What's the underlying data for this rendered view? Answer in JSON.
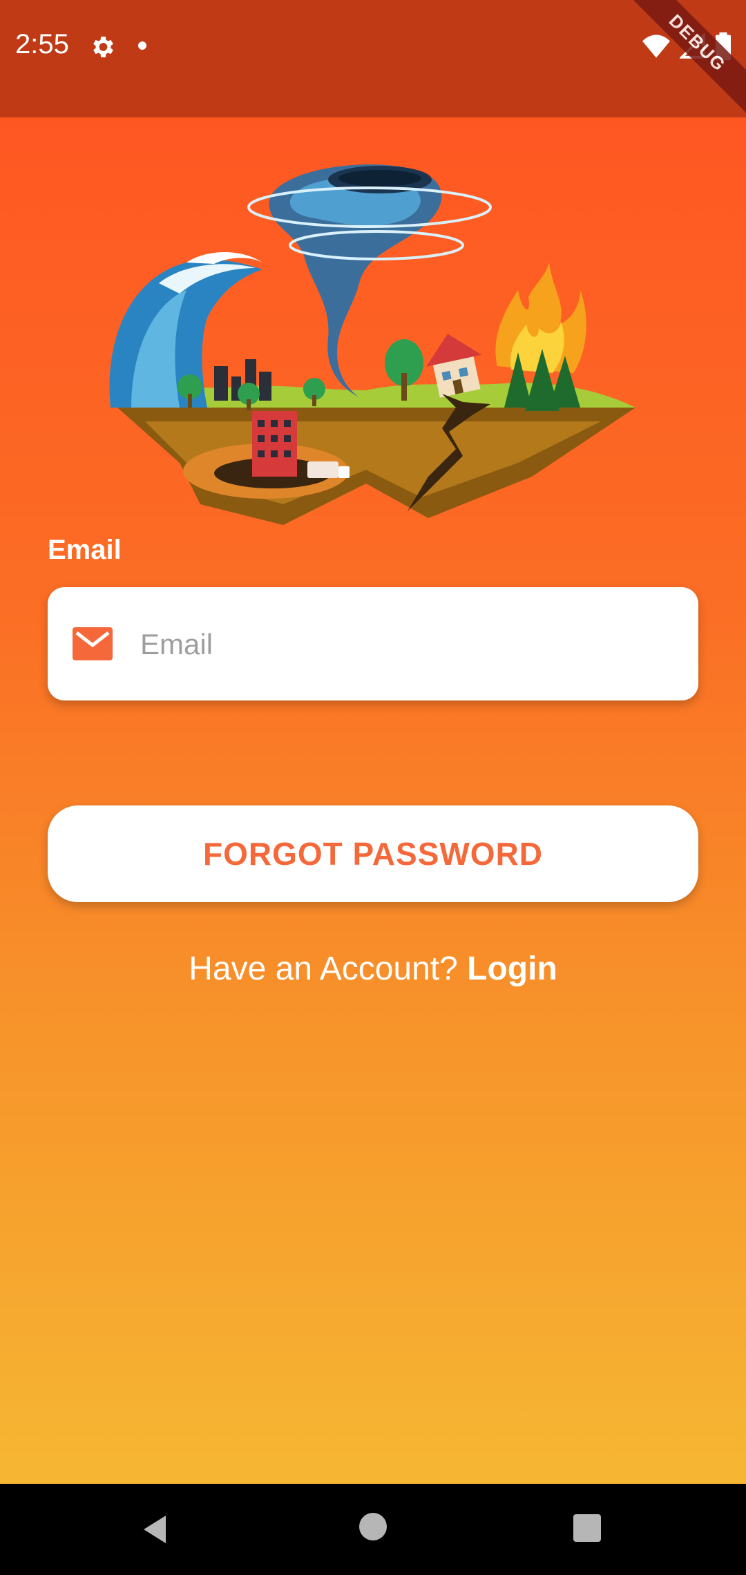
{
  "status_bar": {
    "time": "2:55",
    "icons": [
      "gear-icon",
      "notification-dot-icon",
      "wifi-icon",
      "signal-icon",
      "battery-icon"
    ],
    "debug_banner": "DEBUG"
  },
  "illustration": {
    "icon": "natural-disasters-illustration"
  },
  "form": {
    "email_label": "Email",
    "email_placeholder": "Email",
    "email_value": "",
    "email_icon": "mail-icon",
    "forgot_button_label": "FORGOT PASSWORD"
  },
  "footer": {
    "prompt_text": "Have an Account? ",
    "login_link": "Login"
  },
  "nav_bar": {
    "icons": [
      "back-icon",
      "home-icon",
      "recents-icon"
    ]
  },
  "colors": {
    "status_bar": "#bf3a15",
    "gradient_top": "#ff5722",
    "gradient_bottom": "#f6b733",
    "accent": "#f4683a"
  }
}
